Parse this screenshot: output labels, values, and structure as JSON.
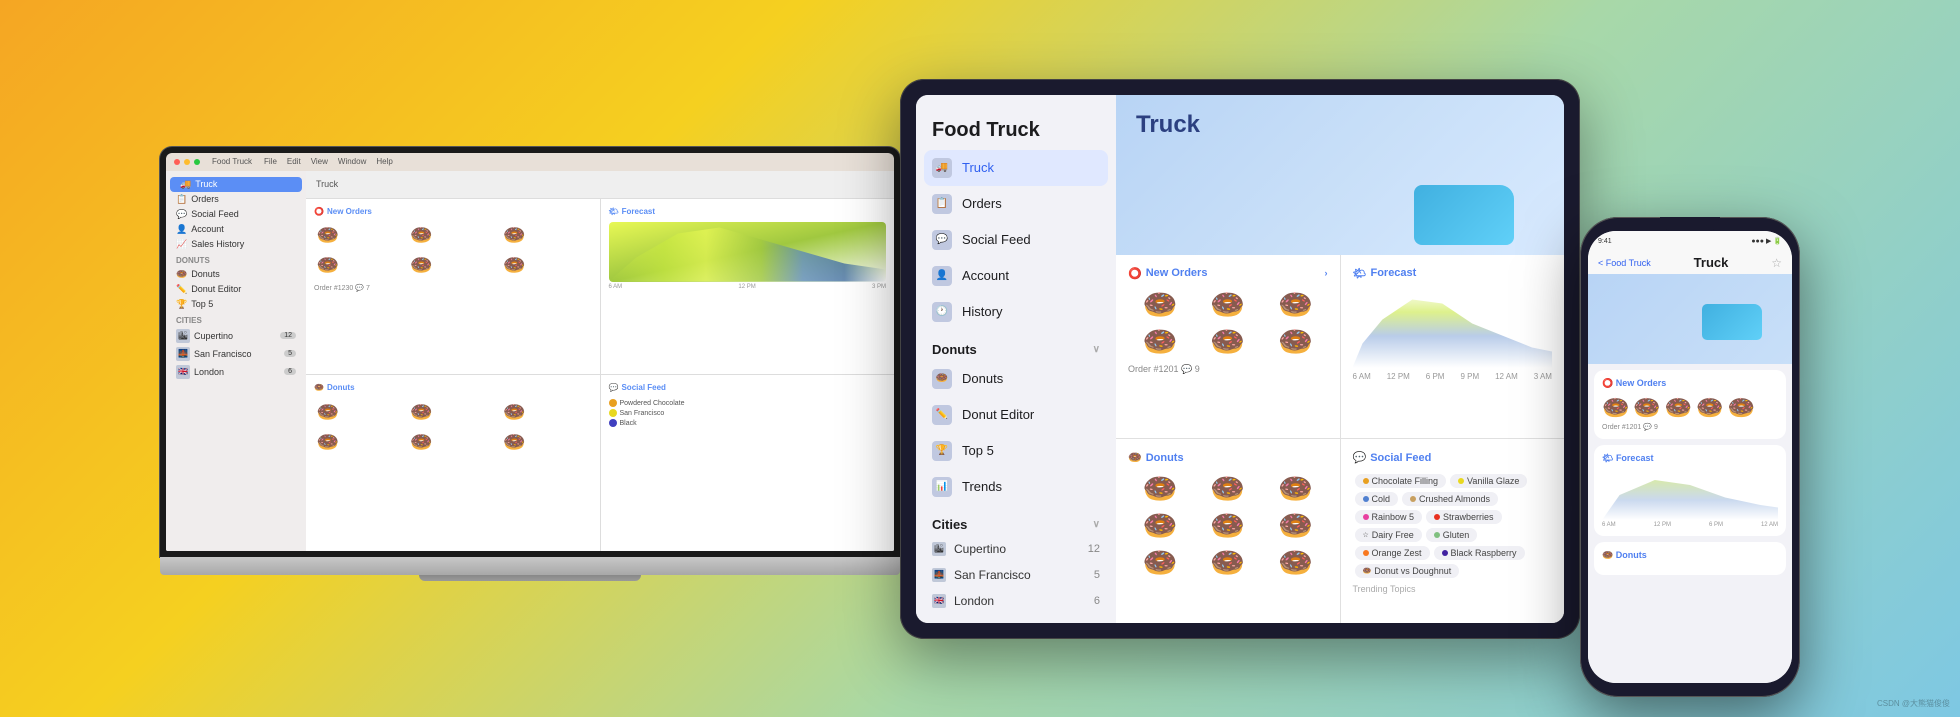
{
  "background": {
    "gradient": "linear-gradient(135deg, #f5a623 0%, #f5d020 30%, #a8d8a8 60%, #7ec8e3 100%)"
  },
  "macbook": {
    "menubar": {
      "app_name": "Food Truck",
      "menus": [
        "File",
        "Edit",
        "View",
        "Window",
        "Help"
      ]
    },
    "sidebar": {
      "items": [
        {
          "label": "Truck",
          "icon": "🚚",
          "active": true
        },
        {
          "label": "Orders",
          "icon": "📋"
        },
        {
          "label": "Social Feed",
          "icon": "💬"
        },
        {
          "label": "Account",
          "icon": "👤"
        },
        {
          "label": "Sales History",
          "icon": "📈"
        }
      ],
      "sections": {
        "donuts": {
          "label": "Donuts",
          "items": [
            {
              "label": "Donuts"
            },
            {
              "label": "Donut Editor"
            },
            {
              "label": "Top 5"
            }
          ]
        },
        "cities": {
          "label": "Cities",
          "items": [
            {
              "label": "Cupertino",
              "badge": "12"
            },
            {
              "label": "San Francisco",
              "badge": "5"
            },
            {
              "label": "London",
              "badge": "6"
            }
          ]
        }
      }
    },
    "toolbar": {
      "title": "Truck"
    },
    "panels": {
      "new_orders": {
        "label": "New Orders",
        "order_label": "Order #1230",
        "count": "7"
      },
      "forecast": {
        "label": "Forecast"
      },
      "donuts": {
        "label": "Donuts"
      },
      "social_feed": {
        "label": "Social Feed"
      }
    }
  },
  "ipad": {
    "sidebar": {
      "app_title": "Food Truck",
      "nav_items": [
        {
          "label": "Truck",
          "active": true
        },
        {
          "label": "Orders"
        },
        {
          "label": "Social Feed"
        },
        {
          "label": "Account"
        },
        {
          "label": "History"
        }
      ],
      "sections": {
        "donuts": {
          "label": "Donuts",
          "items": [
            {
              "label": "Donuts"
            },
            {
              "label": "Donut Editor"
            },
            {
              "label": "Top 5"
            },
            {
              "label": "Trends"
            }
          ]
        },
        "cities": {
          "label": "Cities",
          "items": [
            {
              "label": "Cupertino",
              "badge": "12"
            },
            {
              "label": "San Francisco",
              "badge": "5"
            },
            {
              "label": "London",
              "badge": "6"
            }
          ]
        }
      }
    },
    "hero": {
      "title": "Truck"
    },
    "panels": {
      "new_orders": {
        "label": "New Orders",
        "order_label": "Order #1201",
        "count": "9"
      },
      "forecast": {
        "label": "Forecast"
      },
      "donuts": {
        "label": "Donuts"
      },
      "social_feed": {
        "label": "Social Feed",
        "tags": [
          {
            "label": "Chocolate Filling"
          },
          {
            "label": "Vanilla Glaze"
          },
          {
            "label": "Cold"
          },
          {
            "label": "Crushed Almonds"
          },
          {
            "label": "Rainbow 5"
          },
          {
            "label": "Strawberries"
          },
          {
            "label": "Dairy Free"
          },
          {
            "label": "Gluten"
          },
          {
            "label": "Orange Zest"
          },
          {
            "label": "Black Raspberry"
          },
          {
            "label": "Donut vs Doughnut"
          },
          {
            "label": "Trending Topics"
          }
        ]
      }
    }
  },
  "iphone": {
    "statusbar": {
      "time": "9:41",
      "signal": "●●●",
      "battery": "▮▮▮"
    },
    "navbar": {
      "back_label": "< Food Truck",
      "title": "Truck",
      "star_icon": "☆"
    },
    "panels": {
      "new_orders": {
        "label": "New Orders",
        "order_label": "Order #1201",
        "count": "9"
      },
      "forecast": {
        "label": "Forecast"
      },
      "donuts": {
        "label": "Donuts"
      }
    }
  },
  "donuts_emoji": [
    "🍩",
    "🍩",
    "🍩",
    "🍩",
    "🍩",
    "🍩",
    "🍩",
    "🍩",
    "🍩"
  ],
  "credit": "CSDN @大熊猫俊俊"
}
